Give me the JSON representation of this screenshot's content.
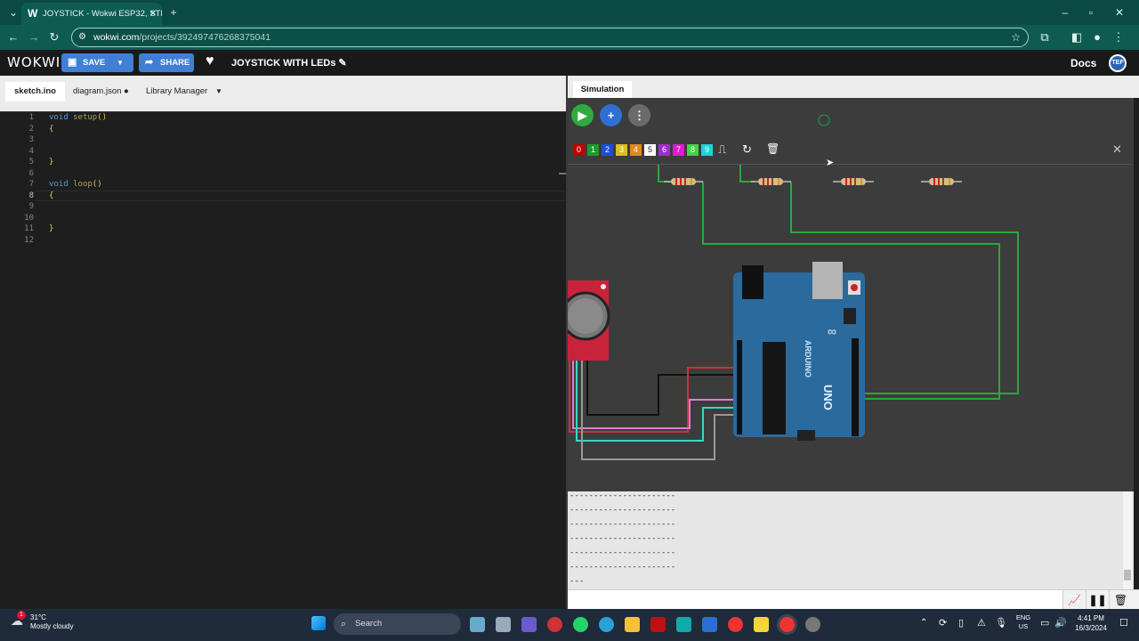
{
  "browser": {
    "tab_title": "JOYSTICK - Wokwi ESP32, STM",
    "tab_favicon": "W",
    "url_host": "wokwi.com",
    "url_path": "/projects/392497476268375041"
  },
  "header": {
    "logo": "WOKWI",
    "save_label": "SAVE",
    "share_label": "SHARE",
    "project_name": "JOYSTICK WITH LEDs",
    "docs_label": "Docs",
    "avatar_text": "TEF",
    "accent_color": "#3f7fd6"
  },
  "editor": {
    "tabs": [
      {
        "label": "sketch.ino"
      },
      {
        "label": "diagram.json"
      },
      {
        "label": "Library Manager"
      }
    ],
    "lines": [
      {
        "num": "1",
        "text": "void setup()"
      },
      {
        "num": "2",
        "text": "{"
      },
      {
        "num": "3",
        "text": ""
      },
      {
        "num": "4",
        "text": ""
      },
      {
        "num": "5",
        "text": "}"
      },
      {
        "num": "6",
        "text": ""
      },
      {
        "num": "7",
        "text": "void loop()"
      },
      {
        "num": "8",
        "text": "{"
      },
      {
        "num": "9",
        "text": ""
      },
      {
        "num": "10",
        "text": ""
      },
      {
        "num": "11",
        "text": "}"
      },
      {
        "num": "12",
        "text": ""
      }
    ]
  },
  "simulation": {
    "tab_label": "Simulation",
    "palette": [
      {
        "label": "0",
        "color": "#c00000"
      },
      {
        "label": "1",
        "color": "#1a9c2e"
      },
      {
        "label": "2",
        "color": "#1d4fd6"
      },
      {
        "label": "3",
        "color": "#d6c21d"
      },
      {
        "label": "4",
        "color": "#e08a1a"
      },
      {
        "label": "5",
        "color": "#ffffff"
      },
      {
        "label": "6",
        "color": "#9b2fd0"
      },
      {
        "label": "7",
        "color": "#e01ad0"
      },
      {
        "label": "8",
        "color": "#3fd63f"
      },
      {
        "label": "9",
        "color": "#1ad6d6"
      }
    ],
    "arduino": {
      "brand": "ARDUINO",
      "model": "UNO",
      "left_pins": [
        "IOREF",
        "RESET",
        "3.3V",
        "5V",
        "GND",
        "GND",
        "Vin",
        "A0",
        "A1",
        "A2",
        "A3",
        "A4",
        "A5"
      ],
      "right_pins": [
        "AREF",
        "GND",
        "13",
        "12",
        "~11",
        "~10",
        "~9",
        "8",
        "7",
        "~6",
        "~5",
        "4",
        "~3",
        "2",
        "TX→1",
        "RX←0"
      ],
      "labels": [
        "POWER",
        "ANALOG IN",
        "DIGITAL (PWM ~)",
        "TX",
        "RX",
        "L",
        "ON"
      ]
    }
  },
  "serial": {
    "lines": [
      "----------------------",
      "----------------------",
      "----------------------",
      "----------------------",
      "----------------------",
      "----------------------",
      "---"
    ]
  },
  "taskbar": {
    "temperature": "31°C",
    "weather": "Mostly cloudy",
    "weather_badge": "1",
    "search_placeholder": "Search",
    "lang_top": "ENG",
    "lang_bottom": "US",
    "time": "4:41 PM",
    "date": "16/3/2024"
  }
}
